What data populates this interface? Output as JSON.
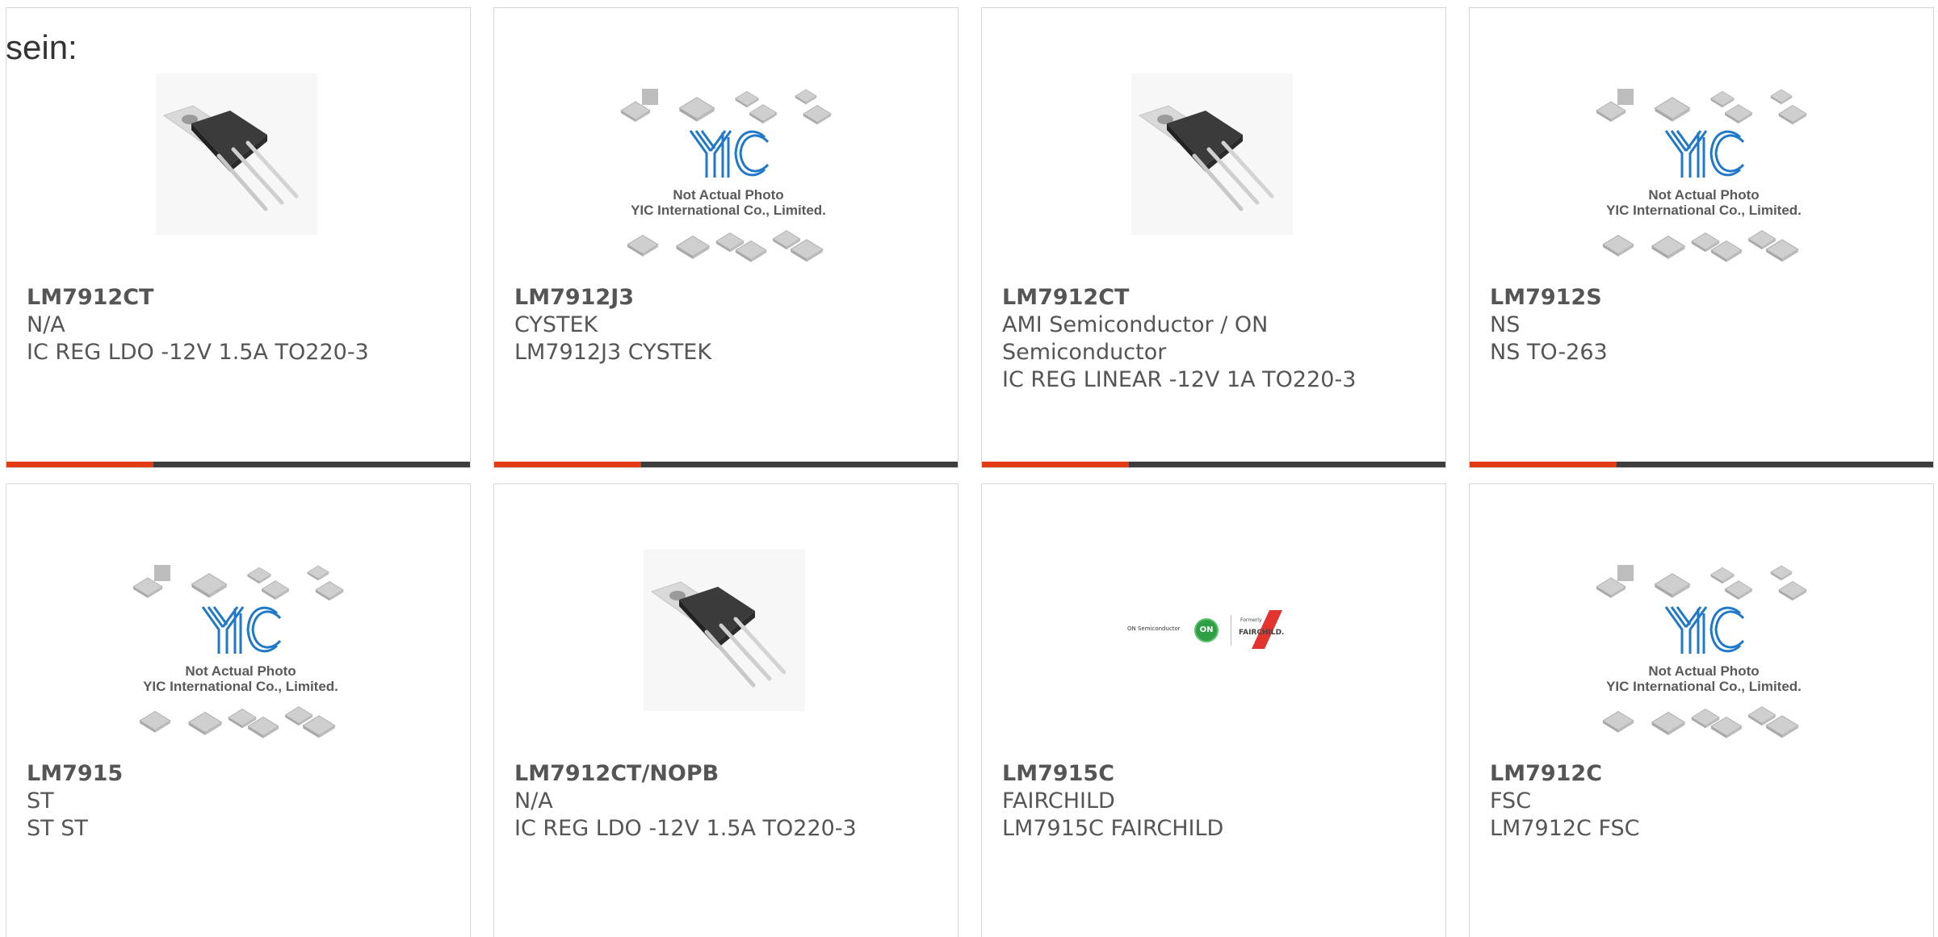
{
  "intro_text": "sein:",
  "placeholder": {
    "caption1": "Not Actual Photo",
    "caption2": "YIC International Co., Limited.",
    "logo_text": "YIC"
  },
  "logo_image": {
    "onsemi_text": "ON Semiconductor",
    "formerly_text": "Formerly",
    "fairchild_text": "FAIRCHILD."
  },
  "colors": {
    "accent": "#e33b14",
    "bar": "#3d3d3d",
    "text": "#555555",
    "yic_blue": "#1f79c8"
  },
  "products": [
    {
      "part": "LM7912CT",
      "maker": "N/A",
      "desc": "IC REG LDO -12V 1.5A TO220-3",
      "image": "to220-photo"
    },
    {
      "part": "LM7912J3",
      "maker": "CYSTEK",
      "desc": "LM7912J3 CYSTEK",
      "image": "placeholder"
    },
    {
      "part": "LM7912CT",
      "maker": "AMI Semiconductor / ON Semiconductor",
      "desc": "IC REG LINEAR -12V 1A TO220-3",
      "image": "to220-photo"
    },
    {
      "part": "LM7912S",
      "maker": "NS",
      "desc": "NS TO-263",
      "image": "placeholder"
    },
    {
      "part": "LM7915",
      "maker": "ST",
      "desc": "ST ST",
      "image": "placeholder"
    },
    {
      "part": "LM7912CT/NOPB",
      "maker": "N/A",
      "desc": "IC REG LDO -12V 1.5A TO220-3",
      "image": "to220-photo"
    },
    {
      "part": "LM7915C",
      "maker": "FAIRCHILD",
      "desc": "LM7915C FAIRCHILD",
      "image": "onsemi-fairchild-logo"
    },
    {
      "part": "LM7912C",
      "maker": "FSC",
      "desc": "LM7912C FSC",
      "image": "placeholder"
    }
  ]
}
